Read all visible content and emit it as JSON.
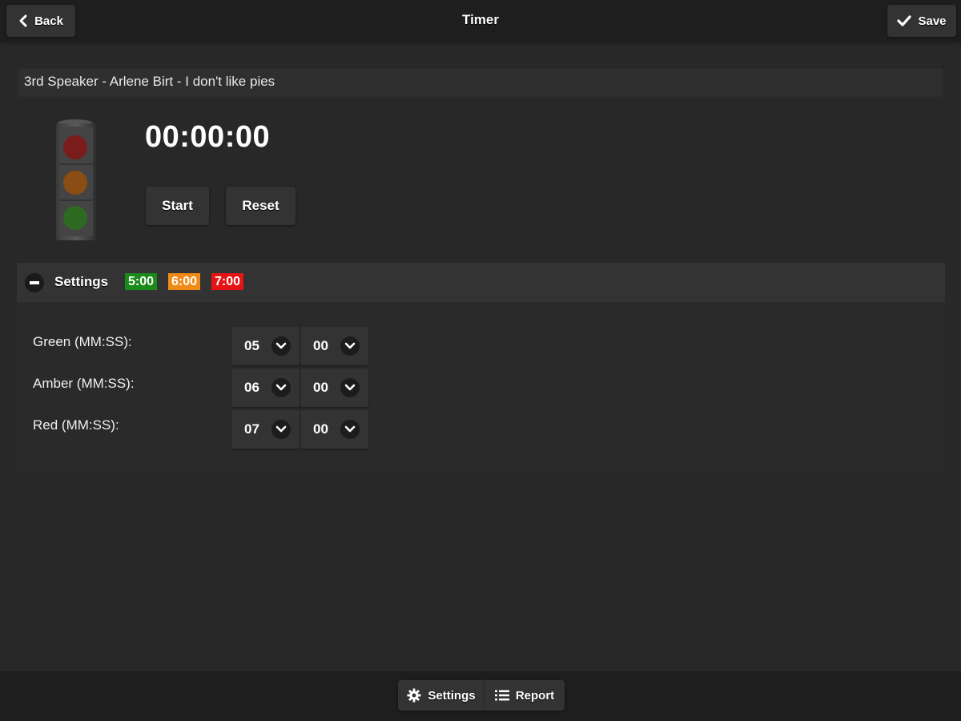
{
  "header": {
    "title": "Timer",
    "back_label": "Back",
    "save_label": "Save",
    "back_icon": "chevron-left-icon",
    "save_icon": "check-icon"
  },
  "speaker_field": {
    "value": "3rd Speaker - Arlene Birt - I don't like pies"
  },
  "timer": {
    "display": "00:00:00",
    "start_label": "Start",
    "reset_label": "Reset",
    "traffic_light_icon": "traffic-light-icon"
  },
  "settings": {
    "title": "Settings",
    "expanded": true,
    "badges": [
      {
        "label": "5:00",
        "color": "#1a8a1a"
      },
      {
        "label": "6:00",
        "color": "#f08a16"
      },
      {
        "label": "7:00",
        "color": "#e51414"
      }
    ],
    "rows": [
      {
        "label": "Green (MM:SS):",
        "minutes": "05",
        "seconds": "00"
      },
      {
        "label": "Amber (MM:SS):",
        "minutes": "06",
        "seconds": "00"
      },
      {
        "label": "Red (MM:SS):",
        "minutes": "07",
        "seconds": "00"
      }
    ]
  },
  "footer": {
    "settings_label": "Settings",
    "report_label": "Report",
    "settings_icon": "gear-icon",
    "report_icon": "list-icon"
  },
  "colors": {
    "background": "#282828",
    "bar": "#1e1e1e",
    "button": "#333333"
  }
}
